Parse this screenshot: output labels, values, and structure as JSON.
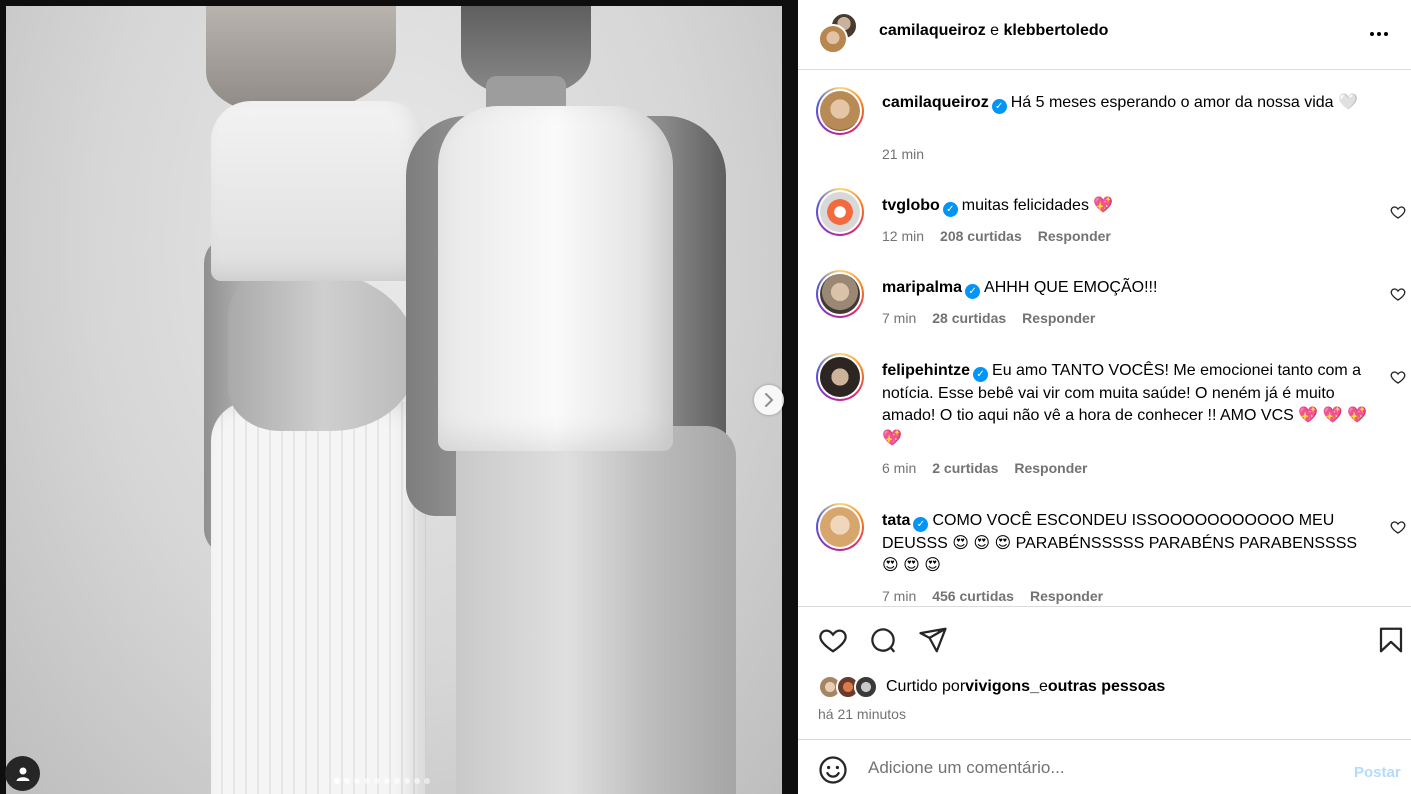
{
  "header": {
    "user1": "camilaqueiroz",
    "joiner": " e ",
    "user2": "klebbertoledo"
  },
  "caption": {
    "username": "camilaqueiroz",
    "text": "Há 5 meses esperando o amor da nossa vida 🤍",
    "time": "21 min"
  },
  "comments": [
    {
      "username": "tvglobo",
      "text": "muitas felicidades 💖",
      "time": "12 min",
      "likes": "208 curtidas",
      "reply": "Responder"
    },
    {
      "username": "maripalma",
      "text": "AHHH QUE EMOÇÃO!!!",
      "time": "7 min",
      "likes": "28 curtidas",
      "reply": "Responder"
    },
    {
      "username": "felipehintze",
      "text": "Eu amo TANTO VOCÊS! Me emocionei tanto com a notícia. Esse bebê vai vir com muita saúde! O neném já é muito amado! O tio aqui não vê a hora de conhecer !! AMO VCS 💖 💖 💖 💖",
      "time": "6 min",
      "likes": "2 curtidas",
      "reply": "Responder"
    },
    {
      "username": "tata",
      "text": "COMO VOCÊ ESCONDEU ISSOOOOOOOOOOO MEU DEUSSS 😍 😍 😍 PARABÉNSSSSS PARABÉNS PARABENSSSS 😍 😍 😍",
      "time": "7 min",
      "likes": "456 curtidas",
      "reply": "Responder"
    }
  ],
  "likes": {
    "prefix": "Curtido por ",
    "user": "vivigons_",
    "joiner": " e ",
    "others": "outras pessoas"
  },
  "posted": "há 21 minutos",
  "comment_box": {
    "placeholder": "Adicione um comentário...",
    "post_label": "Postar"
  },
  "carousel": {
    "count": 10,
    "active": 0
  },
  "colors": {
    "verified": "#0095f6",
    "post_disabled": "#b3dbff",
    "meta_gray": "#737373"
  }
}
